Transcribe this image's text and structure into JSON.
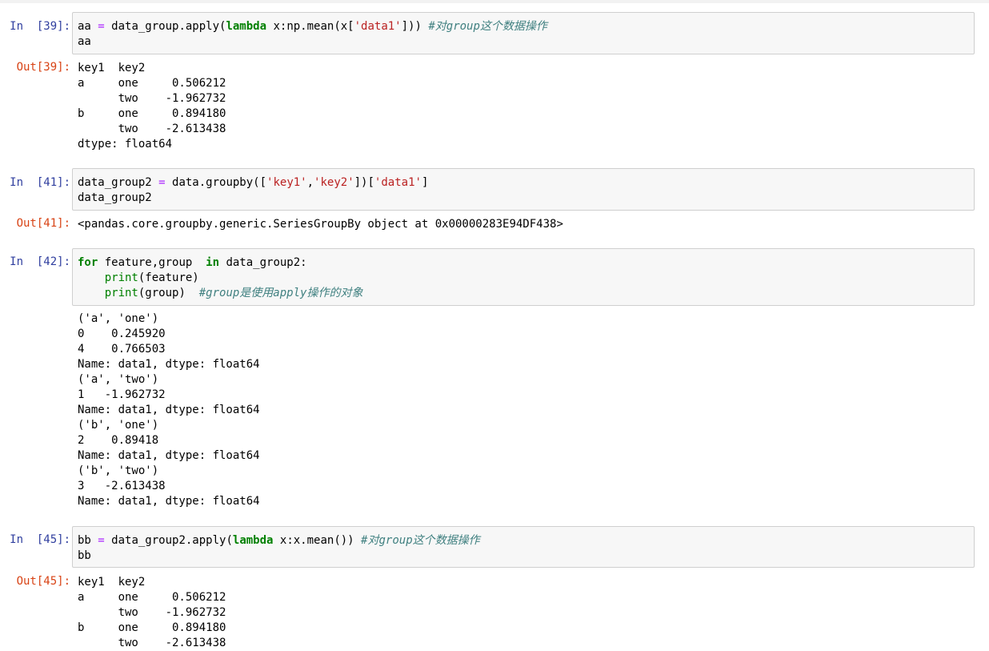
{
  "cells": [
    {
      "in_prompt": "In  [39]:",
      "input_lines": [
        [
          {
            "t": "aa ",
            "c": "tok"
          },
          {
            "t": "=",
            "c": "op"
          },
          {
            "t": " data_group.apply(",
            "c": "tok"
          },
          {
            "t": "lambda",
            "c": "kw"
          },
          {
            "t": " x:np.mean(x[",
            "c": "tok"
          },
          {
            "t": "'data1'",
            "c": "str"
          },
          {
            "t": "])) ",
            "c": "tok"
          },
          {
            "t": "#对group这个数据操作",
            "c": "cm"
          }
        ],
        [
          {
            "t": "aa",
            "c": "tok"
          }
        ]
      ],
      "out_prompt": "Out[39]:",
      "output_lines": [
        "key1  key2",
        "a     one     0.506212",
        "      two    -1.962732",
        "b     one     0.894180",
        "      two    -2.613438",
        "dtype: float64"
      ]
    },
    {
      "in_prompt": "In  [41]:",
      "input_lines": [
        [
          {
            "t": "data_group2 ",
            "c": "tok"
          },
          {
            "t": "=",
            "c": "op"
          },
          {
            "t": " data.groupby([",
            "c": "tok"
          },
          {
            "t": "'key1'",
            "c": "str"
          },
          {
            "t": ",",
            "c": "tok"
          },
          {
            "t": "'key2'",
            "c": "str"
          },
          {
            "t": "])[",
            "c": "tok"
          },
          {
            "t": "'data1'",
            "c": "str"
          },
          {
            "t": "]",
            "c": "tok"
          }
        ],
        [
          {
            "t": "data_group2",
            "c": "tok"
          }
        ]
      ],
      "out_prompt": "Out[41]:",
      "output_lines": [
        "<pandas.core.groupby.generic.SeriesGroupBy object at 0x00000283E94DF438>"
      ]
    },
    {
      "in_prompt": "In  [42]:",
      "input_lines": [
        [
          {
            "t": "for",
            "c": "kw"
          },
          {
            "t": " feature,group  ",
            "c": "tok"
          },
          {
            "t": "in",
            "c": "kw"
          },
          {
            "t": " data_group2:",
            "c": "tok"
          }
        ],
        [
          {
            "t": "    ",
            "c": "tok"
          },
          {
            "t": "print",
            "c": "bi"
          },
          {
            "t": "(feature)",
            "c": "tok"
          }
        ],
        [
          {
            "t": "    ",
            "c": "tok"
          },
          {
            "t": "print",
            "c": "bi"
          },
          {
            "t": "(group)  ",
            "c": "tok"
          },
          {
            "t": "#group是使用apply操作的对象",
            "c": "cm"
          }
        ]
      ],
      "out_prompt": "",
      "output_lines": [
        "('a', 'one')",
        "0    0.245920",
        "4    0.766503",
        "Name: data1, dtype: float64",
        "('a', 'two')",
        "1   -1.962732",
        "Name: data1, dtype: float64",
        "('b', 'one')",
        "2    0.89418",
        "Name: data1, dtype: float64",
        "('b', 'two')",
        "3   -2.613438",
        "Name: data1, dtype: float64"
      ]
    },
    {
      "in_prompt": "In  [45]:",
      "input_lines": [
        [
          {
            "t": "bb ",
            "c": "tok"
          },
          {
            "t": "=",
            "c": "op"
          },
          {
            "t": " data_group2.apply(",
            "c": "tok"
          },
          {
            "t": "lambda",
            "c": "kw"
          },
          {
            "t": " x:x.mean()) ",
            "c": "tok"
          },
          {
            "t": "#对group这个数据操作",
            "c": "cm"
          }
        ],
        [
          {
            "t": "bb",
            "c": "tok"
          }
        ]
      ],
      "out_prompt": "Out[45]:",
      "output_lines": [
        "key1  key2",
        "a     one     0.506212",
        "      two    -1.962732",
        "b     one     0.894180",
        "      two    -2.613438"
      ]
    }
  ]
}
